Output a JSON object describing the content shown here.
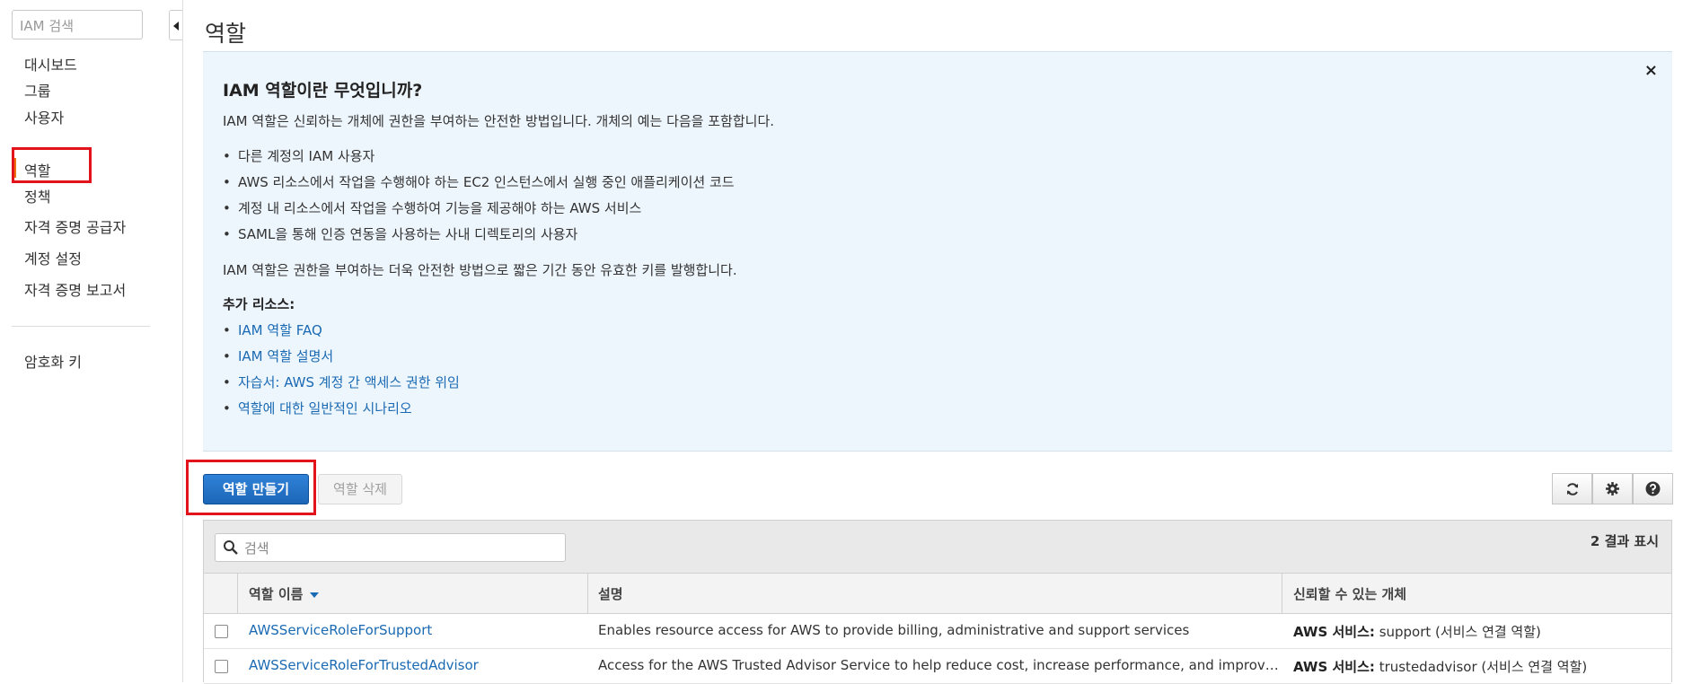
{
  "sidebar": {
    "search_placeholder": "IAM 검색",
    "items": [
      {
        "label": "대시보드"
      },
      {
        "label": "그룹"
      },
      {
        "label": "사용자"
      },
      {
        "label": "역할"
      },
      {
        "label": "정책"
      },
      {
        "label": "자격 증명 공급자"
      },
      {
        "label": "계정 설정"
      },
      {
        "label": "자격 증명 보고서"
      }
    ],
    "extra_item": "암호화 키"
  },
  "page_title": "역할",
  "info": {
    "title": "IAM 역할이란 무엇입니까?",
    "intro": "IAM 역할은 신뢰하는 개체에 권한을 부여하는 안전한 방법입니다. 개체의 예는 다음을 포함합니다.",
    "examples": [
      "다른 계정의 IAM 사용자",
      "AWS 리소스에서 작업을 수행해야 하는 EC2 인스턴스에서 실행 중인 애플리케이션 코드",
      "계정 내 리소스에서 작업을 수행하여 기능을 제공해야 하는 AWS 서비스",
      "SAML을 통해 인증 연동을 사용하는 사내 디렉토리의 사용자"
    ],
    "summary": "IAM 역할은 권한을 부여하는 더욱 안전한 방법으로 짧은 기간 동안 유효한 키를 발행합니다.",
    "resources_heading": "추가 리소스:",
    "links": [
      "IAM 역할 FAQ",
      "IAM 역할 설명서",
      "자습서: AWS 계정 간 액세스 권한 위임",
      "역할에 대한 일반적인 시나리오"
    ],
    "close_icon": "×"
  },
  "actions": {
    "create_label": "역할 만들기",
    "delete_label": "역할 삭제"
  },
  "table": {
    "search_placeholder": "검색",
    "result_count": "2 결과 표시",
    "columns": [
      "역할 이름",
      "설명",
      "신뢰할 수 있는 개체"
    ],
    "rows": [
      {
        "name": "AWSServiceRoleForSupport",
        "description": "Enables resource access for AWS to provide billing, administrative and support services",
        "trust_label": "AWS 서비스:",
        "trust_value": "support (서비스 연결 역할)"
      },
      {
        "name": "AWSServiceRoleForTrustedAdvisor",
        "description": "Access for the AWS Trusted Advisor Service to help reduce cost, increase performance, and improve security",
        "trust_label": "AWS 서비스:",
        "trust_value": "trustedadvisor (서비스 연결 역할)"
      }
    ]
  },
  "colors": {
    "primary_button": "#1c66b7",
    "link": "#1a6ab3",
    "info_bg": "#eef6fd",
    "active_accent": "#ec7211",
    "highlight": "#e3131b"
  }
}
